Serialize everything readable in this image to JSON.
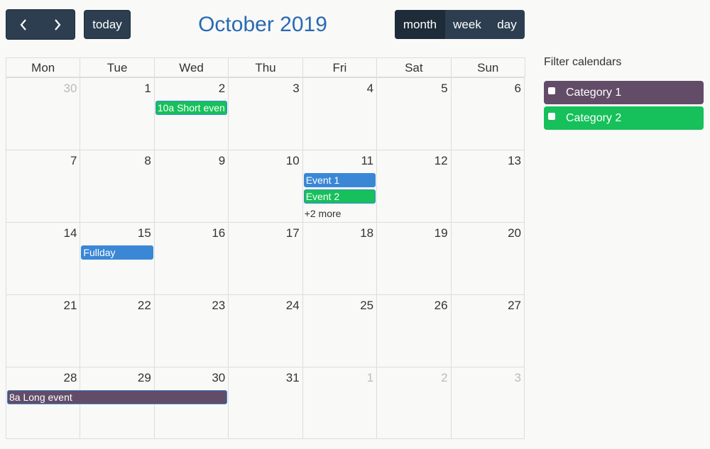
{
  "toolbar": {
    "prev_icon": "‹",
    "next_icon": "›",
    "today_label": "today",
    "title": "October 2019",
    "views": [
      {
        "label": "month",
        "active": true
      },
      {
        "label": "week",
        "active": false
      },
      {
        "label": "day",
        "active": false
      }
    ]
  },
  "calendar": {
    "weekdays": [
      "Mon",
      "Tue",
      "Wed",
      "Thu",
      "Fri",
      "Sat",
      "Sun"
    ],
    "weeks": [
      [
        {
          "d": "30",
          "other": true
        },
        {
          "d": "1"
        },
        {
          "d": "2"
        },
        {
          "d": "3"
        },
        {
          "d": "4"
        },
        {
          "d": "5"
        },
        {
          "d": "6"
        }
      ],
      [
        {
          "d": "7"
        },
        {
          "d": "8"
        },
        {
          "d": "9"
        },
        {
          "d": "10"
        },
        {
          "d": "11"
        },
        {
          "d": "12"
        },
        {
          "d": "13"
        }
      ],
      [
        {
          "d": "14"
        },
        {
          "d": "15"
        },
        {
          "d": "16"
        },
        {
          "d": "17"
        },
        {
          "d": "18"
        },
        {
          "d": "19"
        },
        {
          "d": "20"
        }
      ],
      [
        {
          "d": "21"
        },
        {
          "d": "22"
        },
        {
          "d": "23"
        },
        {
          "d": "24"
        },
        {
          "d": "25"
        },
        {
          "d": "26"
        },
        {
          "d": "27"
        }
      ],
      [
        {
          "d": "28"
        },
        {
          "d": "29"
        },
        {
          "d": "30"
        },
        {
          "d": "31"
        },
        {
          "d": "1",
          "other": true
        },
        {
          "d": "2",
          "other": true
        },
        {
          "d": "3",
          "other": true
        }
      ]
    ],
    "events": [
      {
        "week": 0,
        "day": 2,
        "span": 1,
        "slot": 0,
        "time": "10a",
        "title": "Short even",
        "color": "#16c05a"
      },
      {
        "week": 1,
        "day": 4,
        "span": 1,
        "slot": 0,
        "time": "",
        "title": "Event 1",
        "color": "#3a87d6"
      },
      {
        "week": 1,
        "day": 4,
        "span": 1,
        "slot": 1,
        "time": "",
        "title": "Event 2",
        "color": "#16c05a"
      },
      {
        "week": 2,
        "day": 1,
        "span": 1,
        "slot": 0,
        "time": "",
        "title": "Fullday",
        "color": "#3a87d6"
      },
      {
        "week": 4,
        "day": 0,
        "span": 3,
        "slot": 0,
        "time": "8a",
        "title": "Long event",
        "color": "#634c67"
      }
    ],
    "more_links": [
      {
        "week": 1,
        "day": 4,
        "label": "+2 more"
      }
    ]
  },
  "filter": {
    "title": "Filter calendars",
    "items": [
      {
        "label": "Category 1",
        "color": "#634c67",
        "checked": false
      },
      {
        "label": "Category 2",
        "color": "#16c05a",
        "checked": false
      }
    ]
  }
}
